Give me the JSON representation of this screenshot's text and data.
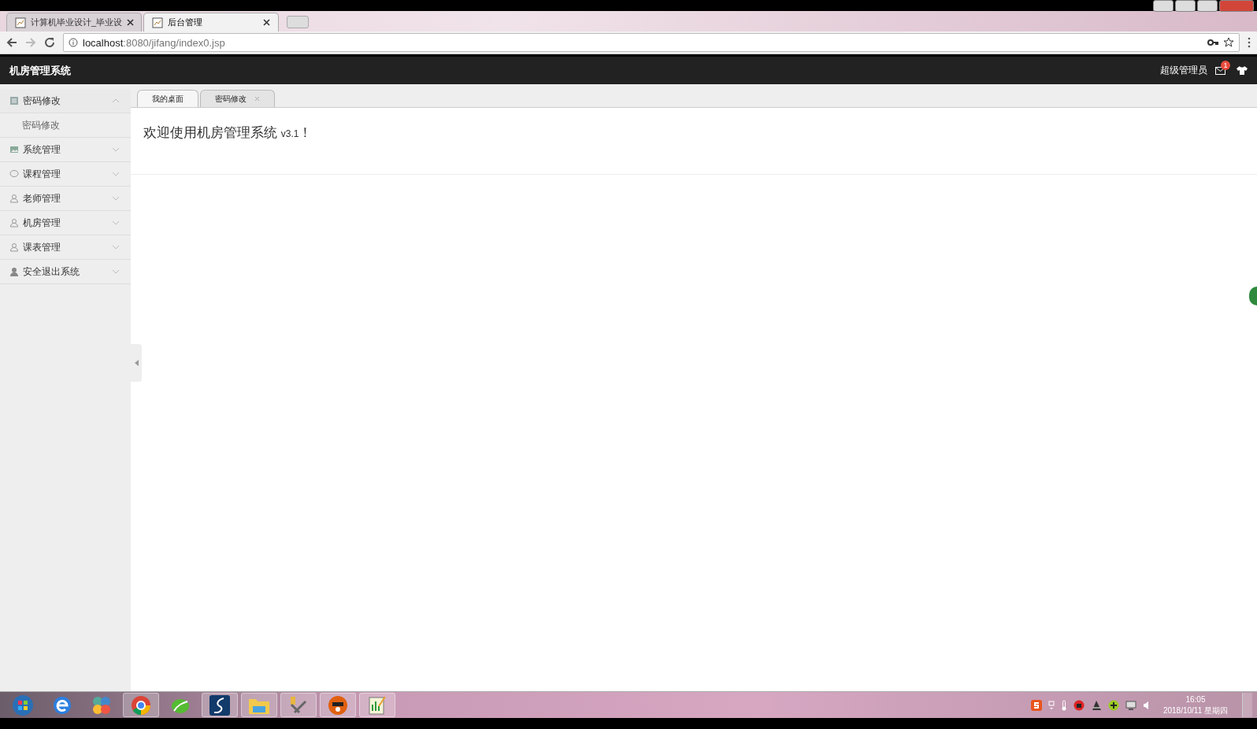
{
  "browser": {
    "tabs": [
      {
        "title": "计算机毕业设计_毕业设",
        "selected": false
      },
      {
        "title": "后台管理",
        "selected": true
      }
    ],
    "address": {
      "host": "localhost",
      "path": ":8080/jifang/index0.jsp"
    }
  },
  "header": {
    "title": "机房管理系统",
    "user": "超级管理员",
    "badge": "1"
  },
  "sidebar": {
    "items": [
      {
        "label": "密码修改",
        "kind": "list",
        "expanded": true,
        "children": [
          {
            "label": "密码修改"
          }
        ]
      },
      {
        "label": "系统管理",
        "kind": "image",
        "expanded": false
      },
      {
        "label": "课程管理",
        "kind": "chat",
        "expanded": false
      },
      {
        "label": "老师管理",
        "kind": "user",
        "expanded": false
      },
      {
        "label": "机房管理",
        "kind": "user",
        "expanded": false
      },
      {
        "label": "课表管理",
        "kind": "user",
        "expanded": false
      },
      {
        "label": "安全退出系统",
        "kind": "userfill",
        "expanded": false
      }
    ]
  },
  "tabs": [
    {
      "label": "我的桌面",
      "selected": true,
      "closable": false
    },
    {
      "label": "密码修改",
      "selected": false,
      "closable": true
    }
  ],
  "welcome": {
    "text": "欢迎使用机房管理系统",
    "version": "v3.1",
    "mark": "！"
  },
  "taskbar": {
    "time": "16:05",
    "date": "2018/10/11 星期四"
  }
}
